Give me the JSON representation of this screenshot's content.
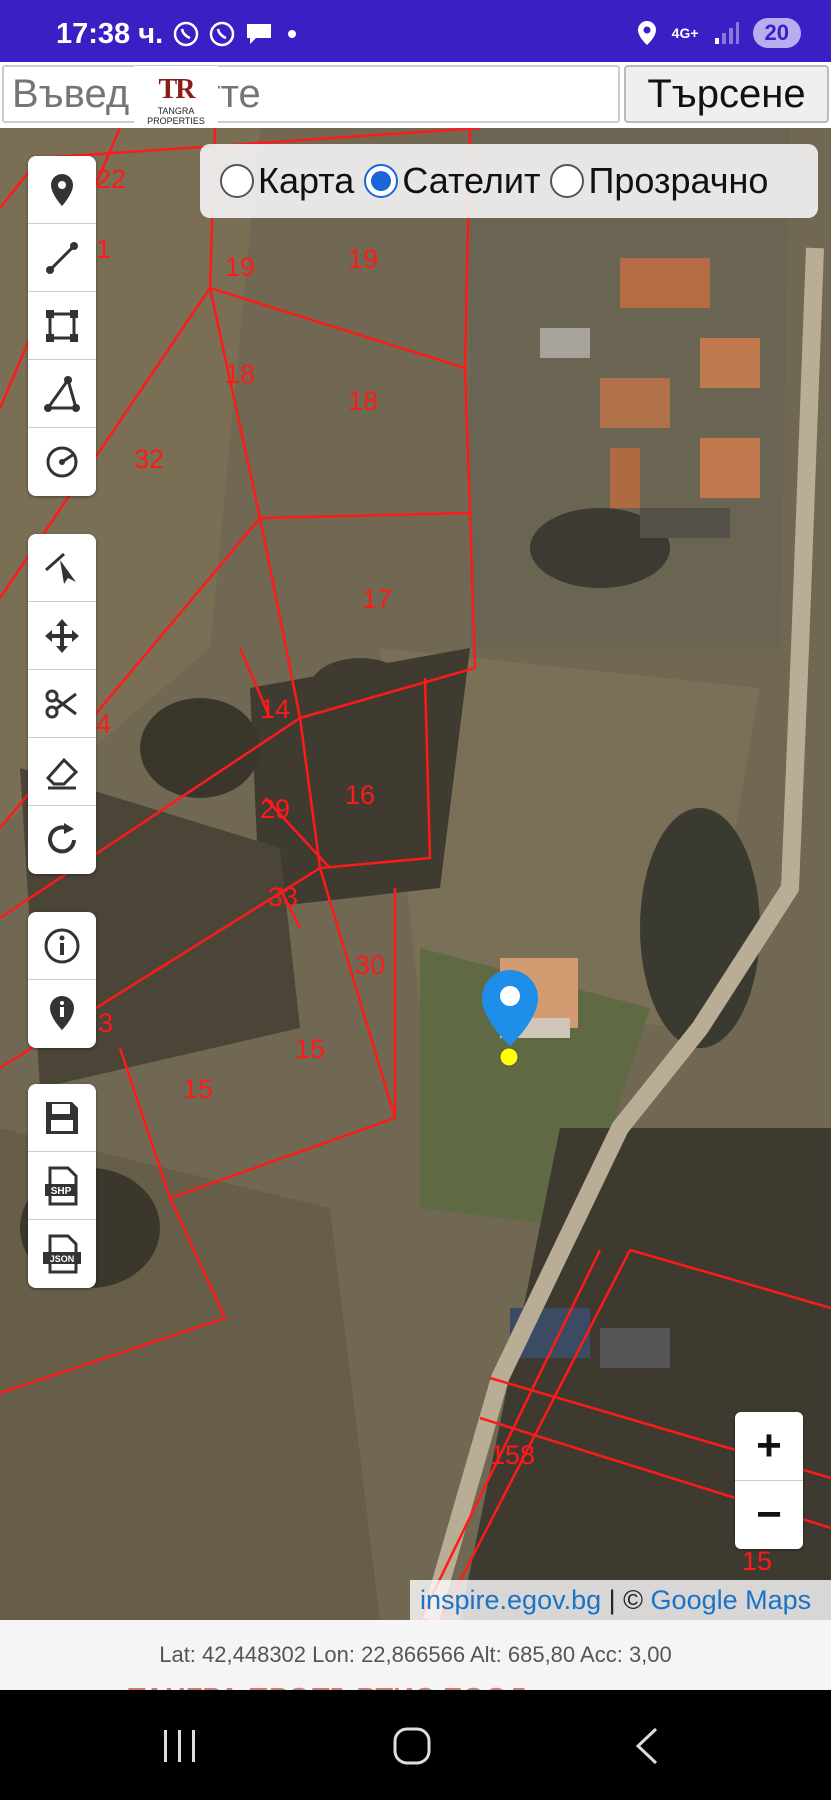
{
  "status_bar": {
    "time": "17:38 ч.",
    "network": "4G+",
    "battery": "20",
    "icons": [
      "viber-icon",
      "viber-icon",
      "chat-icon",
      "dot-icon",
      "location-icon",
      "signal-icon"
    ]
  },
  "search": {
    "placeholder": "Въвед екатте",
    "button_label": "Търсене"
  },
  "logo": {
    "mark": "TR",
    "text": "TANGRA PROPERTIES"
  },
  "map_layers": {
    "selected": "Сателит",
    "options": [
      "Карта",
      "Сателит",
      "Прозрачно"
    ]
  },
  "toolbar": {
    "draw_tools": [
      "marker-icon",
      "polyline-icon",
      "rectangle-icon",
      "polygon-icon",
      "circle-icon"
    ],
    "edit_tools": [
      "edit-vertex-icon",
      "move-icon",
      "cut-icon",
      "eraser-icon",
      "rotate-icon"
    ],
    "info_tools": [
      "info-icon",
      "locate-info-icon"
    ],
    "export_tools": [
      "save-icon",
      "shp-export-icon",
      "json-export-icon"
    ]
  },
  "parcel_labels": [
    "22",
    "1",
    "19",
    "19",
    "18",
    "18",
    "32",
    "17",
    "14",
    "4",
    "16",
    "29",
    "33",
    "30",
    "3",
    "15",
    "15",
    "158",
    "15"
  ],
  "zoom": {
    "in": "+",
    "out": "−"
  },
  "attribution": {
    "link1": "inspire.egov.bg",
    "separator": " | © ",
    "link2": "Google Maps"
  },
  "location": {
    "text": "Lat: 42,448302 Lon: 22,866566 Alt: 685,80 Acc: 3,00"
  },
  "watermark": "ТАНГРА ПРОПЪРТИС  ЕООД"
}
